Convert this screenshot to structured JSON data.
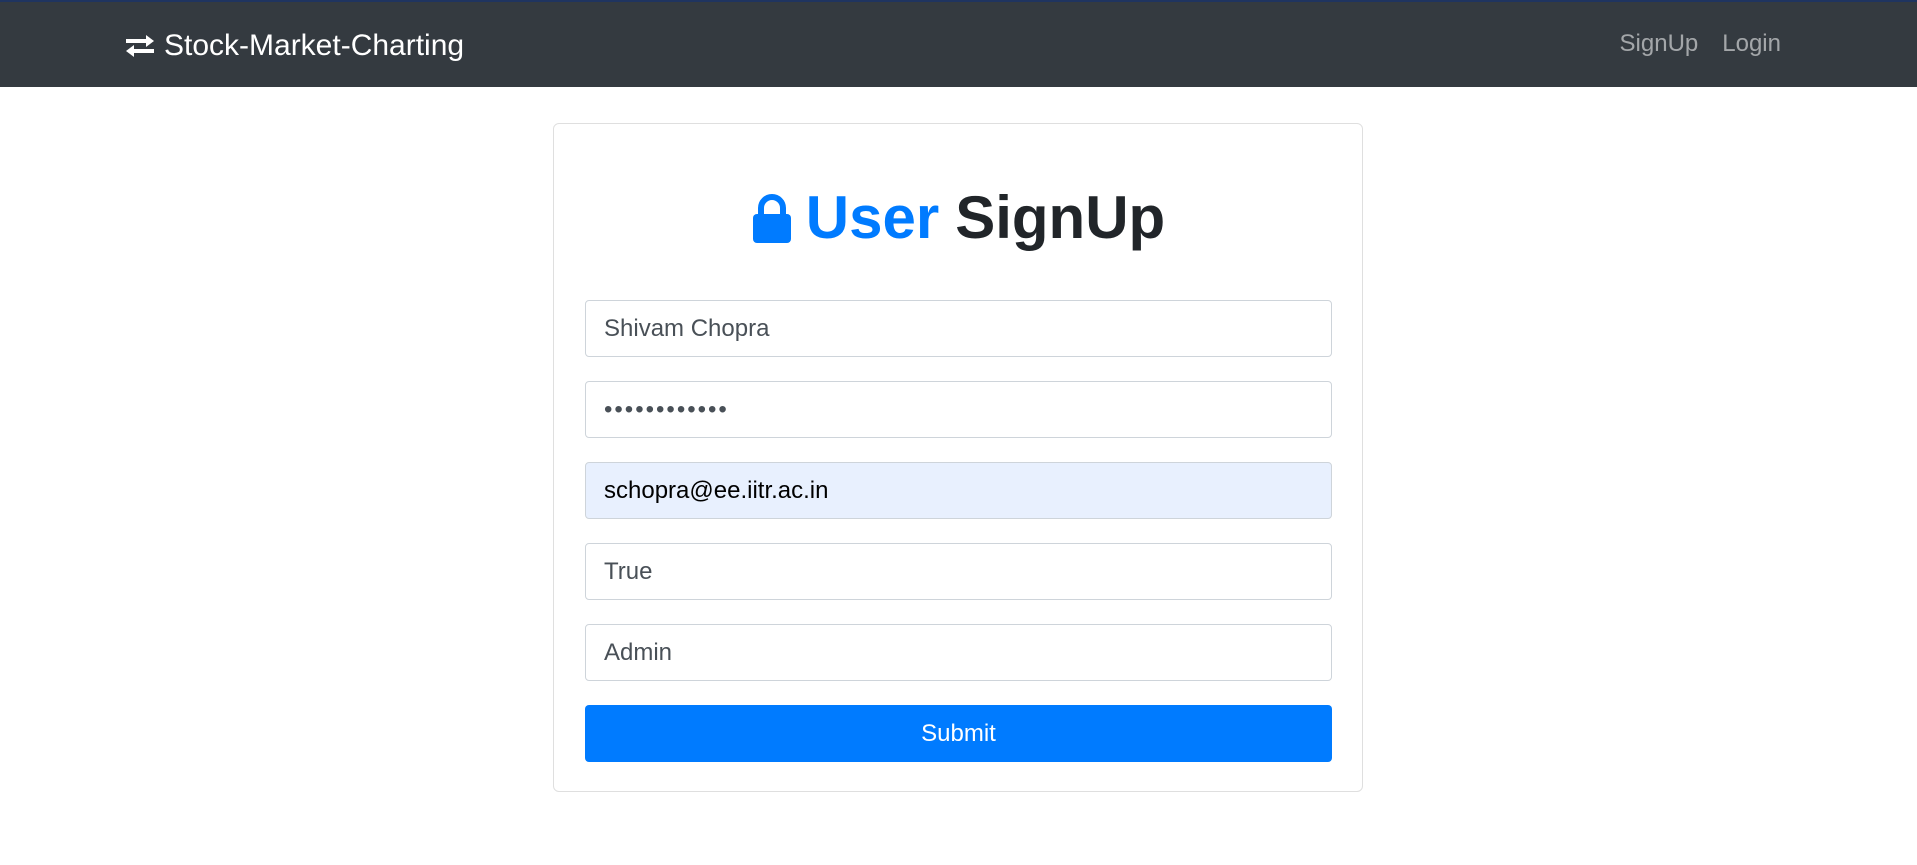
{
  "navbar": {
    "brand_icon": "exchange-arrows-icon",
    "brand_label": "Stock-Market-Charting",
    "links": [
      {
        "label": "SignUp"
      },
      {
        "label": "Login"
      }
    ]
  },
  "form": {
    "heading_icon": "lock-icon",
    "heading_accent": "User",
    "heading_rest": "SignUp",
    "fields": {
      "username": {
        "value": "Shivam Chopra"
      },
      "password": {
        "value": "••••••••••••"
      },
      "email": {
        "value": "schopra@ee.iitr.ac.in"
      },
      "confirmed": {
        "value": "True"
      },
      "role": {
        "value": "Admin"
      }
    },
    "submit_label": "Submit"
  },
  "colors": {
    "navbar_bg": "#343a40",
    "accent": "#007bff",
    "autofill_bg": "#e8f0fe"
  }
}
